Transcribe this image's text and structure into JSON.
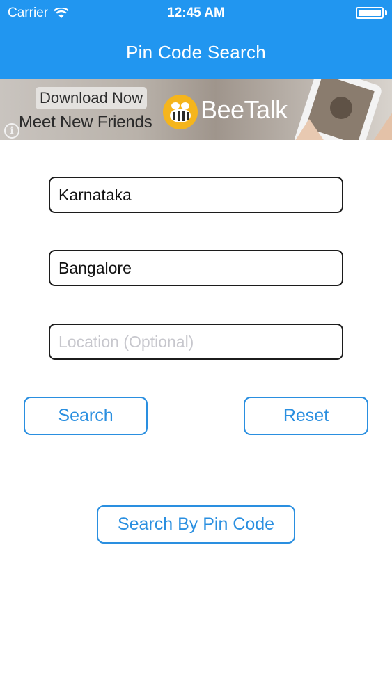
{
  "status_bar": {
    "carrier": "Carrier",
    "time": "12:45 AM",
    "wifi_icon": "wifi-icon",
    "battery_icon": "battery-icon"
  },
  "nav": {
    "title": "Pin Code Search",
    "bar_color": "#2196f0"
  },
  "ad": {
    "cta": "Download Now",
    "tagline": "Meet New Friends",
    "brand": "BeeTalk",
    "info_icon": "info-icon",
    "logo_icon": "bee-logo-icon"
  },
  "form": {
    "state": {
      "value": "Karnataka",
      "placeholder": ""
    },
    "city": {
      "value": "Bangalore",
      "placeholder": ""
    },
    "location": {
      "value": "",
      "placeholder": "Location (Optional)"
    }
  },
  "buttons": {
    "search": "Search",
    "reset": "Reset",
    "search_by_pin": "Search By Pin Code"
  },
  "colors": {
    "accent": "#2a8fe0",
    "field_border": "#1c1c1c"
  }
}
